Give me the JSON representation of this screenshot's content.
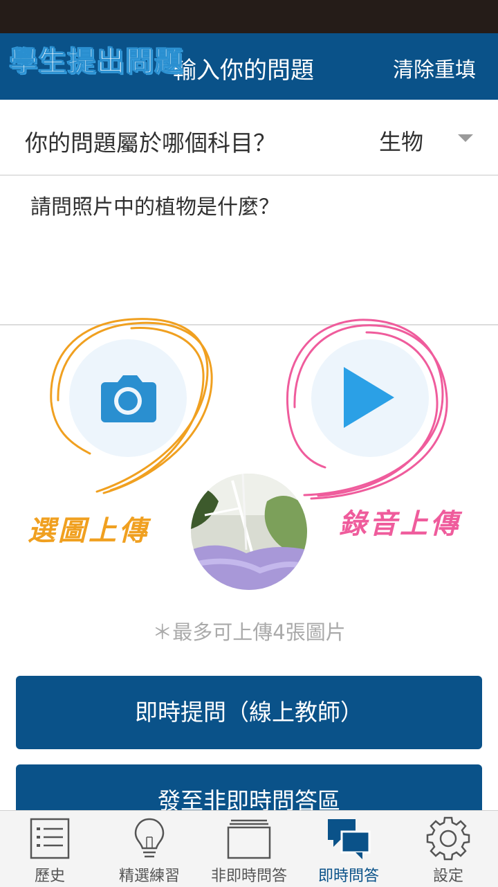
{
  "colors": {
    "primary": "#0a5289",
    "statusbar": "#251c18",
    "camera": "#2a8fd0",
    "play": "#2ba0e6",
    "orange_note": "#f0a020",
    "pink_note": "#ef5c9c"
  },
  "header": {
    "overlay_title": "學生提出問題",
    "title": "輸入你的問題",
    "clear_label": "清除重填"
  },
  "subject": {
    "question": "你的問題屬於哪個科目？",
    "selected": "生物"
  },
  "question_text": "請問照片中的植物是什麼？",
  "media": {
    "camera_icon": "camera-icon",
    "play_icon": "play-icon",
    "note_image": "選圖上傳",
    "note_audio": "錄音上傳",
    "hint": "＊最多可上傳4張圖片"
  },
  "buttons": {
    "instant": "即時提問（線上教師）",
    "non_instant": "發至非即時問答區"
  },
  "tabs": [
    {
      "label": "歷史",
      "icon": "history-list-icon"
    },
    {
      "label": "精選練習",
      "icon": "lightbulb-icon"
    },
    {
      "label": "非即時問答",
      "icon": "stacked-cards-icon"
    },
    {
      "label": "即時問答",
      "icon": "chat-bubbles-icon"
    },
    {
      "label": "設定",
      "icon": "gear-icon"
    }
  ]
}
